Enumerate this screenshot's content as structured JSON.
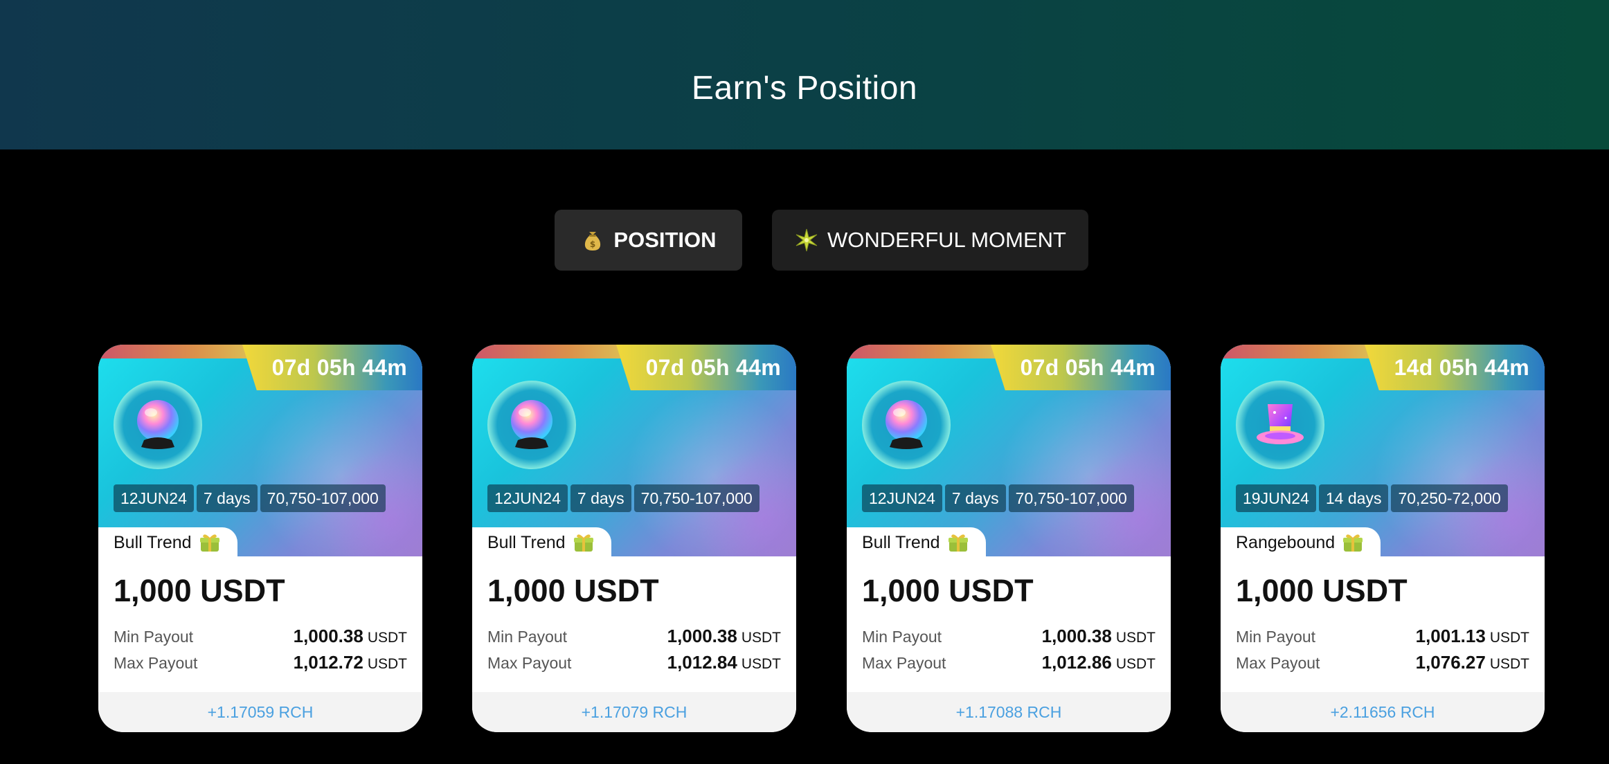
{
  "header": {
    "title": "Earn's Position"
  },
  "tabs": [
    {
      "label": "POSITION",
      "icon": "money-bag-icon",
      "active": true
    },
    {
      "label": "WONDERFUL MOMENT",
      "icon": "sparkle-icon",
      "active": false
    }
  ],
  "cards": [
    {
      "timer": "07d 05h 44m",
      "icon": "crystal-ball-icon",
      "date": "12JUN24",
      "duration": "7 days",
      "range": "70,750-107,000",
      "trend": "Bull Trend",
      "amount": "1,000 USDT",
      "min_label": "Min Payout",
      "min_value": "1,000.38",
      "max_label": "Max Payout",
      "max_value": "1,012.72",
      "unit": "USDT",
      "reward": "+1.17059 RCH"
    },
    {
      "timer": "07d 05h 44m",
      "icon": "crystal-ball-icon",
      "date": "12JUN24",
      "duration": "7 days",
      "range": "70,750-107,000",
      "trend": "Bull Trend",
      "amount": "1,000 USDT",
      "min_label": "Min Payout",
      "min_value": "1,000.38",
      "max_label": "Max Payout",
      "max_value": "1,012.84",
      "unit": "USDT",
      "reward": "+1.17079 RCH"
    },
    {
      "timer": "07d 05h 44m",
      "icon": "crystal-ball-icon",
      "date": "12JUN24",
      "duration": "7 days",
      "range": "70,750-107,000",
      "trend": "Bull Trend",
      "amount": "1,000 USDT",
      "min_label": "Min Payout",
      "min_value": "1,000.38",
      "max_label": "Max Payout",
      "max_value": "1,012.86",
      "unit": "USDT",
      "reward": "+1.17088 RCH"
    },
    {
      "timer": "14d 05h 44m",
      "icon": "magic-hat-icon",
      "date": "19JUN24",
      "duration": "14 days",
      "range": "70,250-72,000",
      "trend": "Rangebound",
      "amount": "1,000 USDT",
      "min_label": "Min Payout",
      "min_value": "1,001.13",
      "max_label": "Max Payout",
      "max_value": "1,076.27",
      "unit": "USDT",
      "reward": "+2.11656 RCH"
    }
  ],
  "colors": {
    "reward_text": "#4aa0e0",
    "tab_bg": "#1f1f1f"
  }
}
